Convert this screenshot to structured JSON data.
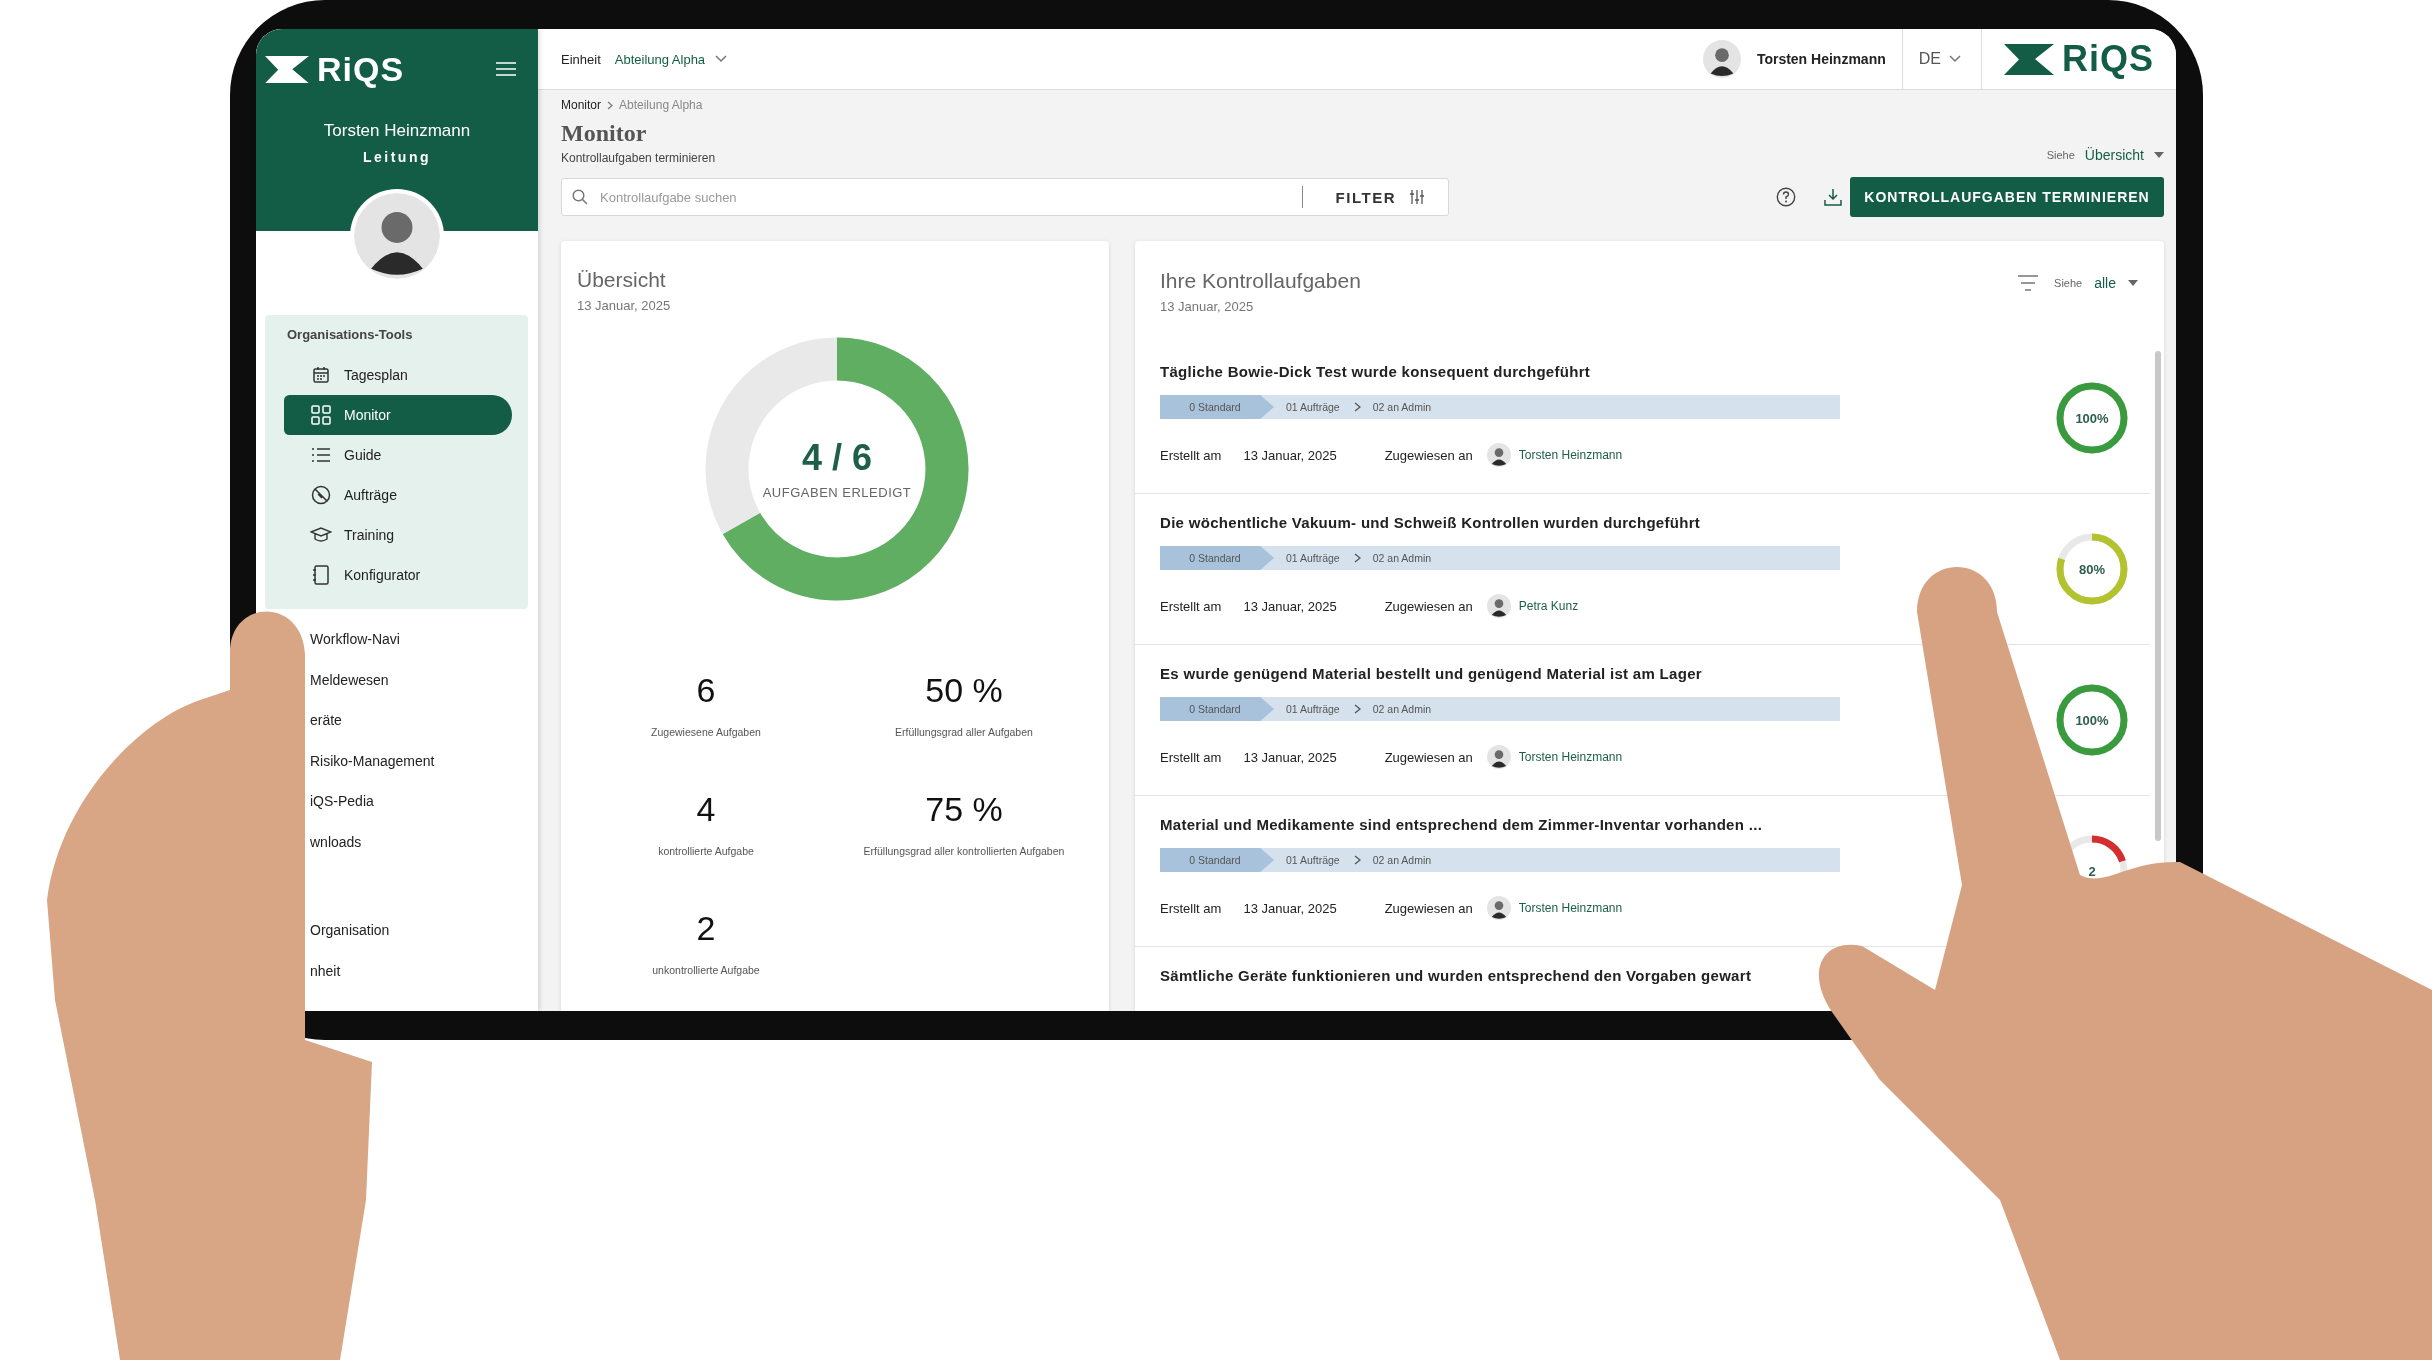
{
  "sidebar": {
    "logo": "RiQS",
    "user_name": "Torsten Heinzmann",
    "role": "Leitung",
    "group": {
      "title": "Organisations-Tools",
      "items": [
        {
          "label": "Tagesplan",
          "selected": false
        },
        {
          "label": "Monitor",
          "selected": true
        },
        {
          "label": "Guide",
          "selected": false
        },
        {
          "label": "Aufträge",
          "selected": false
        },
        {
          "label": "Training",
          "selected": false
        },
        {
          "label": "Konfigurator",
          "selected": false
        }
      ]
    },
    "sections": [
      {
        "items": [
          "Workflow-Navi",
          "Meldewesen",
          "eräte",
          "Risiko-Management",
          "iQS-Pedia",
          "wnloads"
        ]
      },
      {
        "items": [
          "Organisation",
          "nheit"
        ]
      }
    ]
  },
  "topbar": {
    "unit_label": "Einheit",
    "unit_value": "Abteilung Alpha",
    "user_name": "Torsten Heinzmann",
    "language": "DE",
    "logo": "RiQS"
  },
  "header": {
    "breadcrumb": [
      "Monitor",
      "Abteilung Alpha"
    ],
    "title": "Monitor",
    "subtitle": "Kontrollaufgaben terminieren",
    "view_label": "Siehe",
    "view_value": "Übersicht",
    "search_placeholder": "Kontrollaufgabe suchen",
    "filter_label": "FILTER",
    "primary_button": "KONTROLLAUFGABEN TERMINIEREN"
  },
  "overview": {
    "title": "Übersicht",
    "date": "13 Januar, 2025",
    "donut": {
      "level": 0.6667,
      "value": "4 / 6",
      "caption": "AUFGABEN ERLEDIGT"
    },
    "stats": [
      {
        "value": "6",
        "label": "Zugewiesene Aufgaben"
      },
      {
        "value": "50 %",
        "label": "Erfüllungsgrad aller Aufgaben"
      },
      {
        "value": "4",
        "label": "kontrollierte Aufgabe"
      },
      {
        "value": "75 %",
        "label": "Erfüllungsgrad aller kontrollierten Aufgaben"
      },
      {
        "value": "2",
        "label": "unkontrollierte Aufgabe"
      }
    ]
  },
  "tasks": {
    "title": "Ihre Kontrollaufgaben",
    "date": "13 Januar, 2025",
    "view_label": "Siehe",
    "view_value": "alle",
    "items": [
      {
        "title": "Tägliche Bowie-Dick Test wurde konsequent durchgeführt",
        "steps": [
          {
            "label": "0 Standard",
            "current": true
          },
          {
            "label": "01 Aufträge",
            "current": false
          },
          {
            "label": "02 an Admin",
            "current": false
          }
        ],
        "created_label": "Erstellt am",
        "created": "13 Januar, 2025",
        "assigned_label": "Zugewiesen an",
        "assignee": "Torsten Heinzmann",
        "progress": {
          "level": 1,
          "reading": "100%",
          "color": "#3a9a3e"
        }
      },
      {
        "title": "Die wöchentliche Vakuum- und Schweiß Kontrollen wurden durchgeführt",
        "steps": [
          {
            "label": "0 Standard",
            "current": true
          },
          {
            "label": "01 Aufträge",
            "current": false
          },
          {
            "label": "02 an Admin",
            "current": false
          }
        ],
        "created_label": "Erstellt am",
        "created": "13 Januar, 2025",
        "assigned_label": "Zugewiesen an",
        "assignee": "Petra Kunz",
        "progress": {
          "level": 0.8,
          "reading": "80%",
          "color": "#b3c22f"
        }
      },
      {
        "title": "Es wurde genügend Material bestellt und genügend Material ist am Lager",
        "steps": [
          {
            "label": "0 Standard",
            "current": true
          },
          {
            "label": "01 Aufträge",
            "current": false
          },
          {
            "label": "02 an Admin",
            "current": false
          }
        ],
        "created_label": "Erstellt am",
        "created": "13 Januar, 2025",
        "assigned_label": "Zugewiesen an",
        "assignee": "Torsten Heinzmann",
        "progress": {
          "level": 1,
          "reading": "100%",
          "color": "#3a9a3e"
        }
      },
      {
        "title": "Material und Medikamente sind entsprechend dem Zimmer-Inventar vorhanden ...",
        "steps": [
          {
            "label": "0 Standard",
            "current": true
          },
          {
            "label": "01 Aufträge",
            "current": false
          },
          {
            "label": "02 an Admin",
            "current": false
          }
        ],
        "created_label": "Erstellt am",
        "created": "13 Januar, 2025",
        "assigned_label": "Zugewiesen an",
        "assignee": "Torsten Heinzmann",
        "progress": {
          "level": 0.2,
          "reading": "2",
          "color": "#d32f2f"
        }
      },
      {
        "title": "Sämtliche Geräte funktionieren und wurden entsprechend den Vorgaben gewart"
      }
    ]
  }
}
